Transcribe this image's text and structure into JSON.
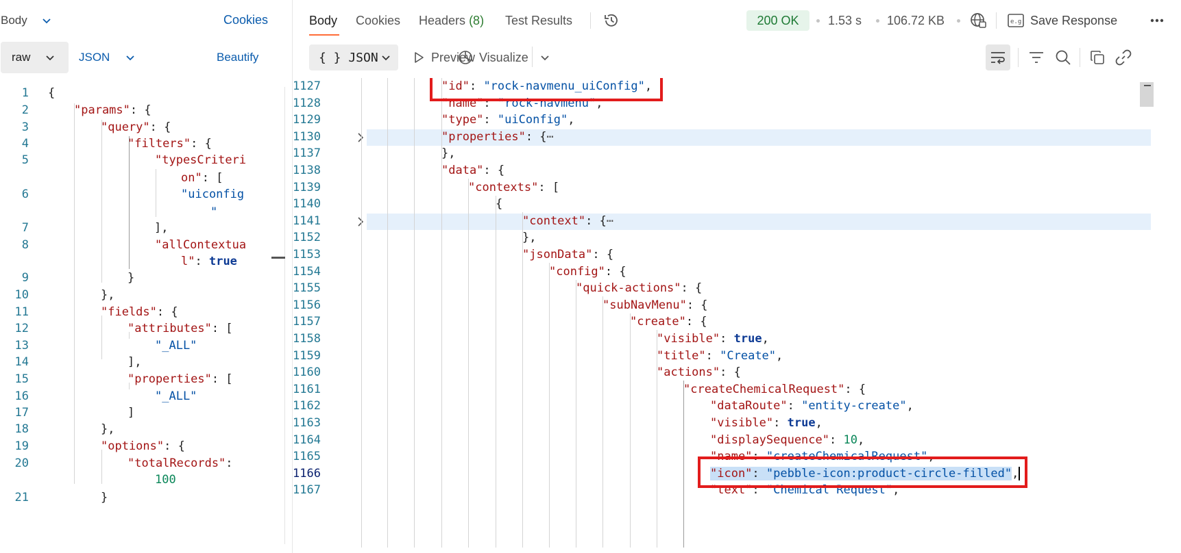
{
  "request": {
    "body_tab": "Body",
    "cookies_link": "Cookies",
    "mode": "raw",
    "language": "JSON",
    "beautify": "Beautify",
    "lines": [
      {
        "n": "1",
        "parts": [
          [
            "p",
            "{"
          ]
        ]
      },
      {
        "n": "2",
        "parts": [
          [
            "k",
            "\"params\""
          ],
          [
            "p",
            ": {"
          ]
        ]
      },
      {
        "n": "3",
        "parts": [
          [
            "k",
            "\"query\""
          ],
          [
            "p",
            ": {"
          ]
        ]
      },
      {
        "n": "4",
        "parts": [
          [
            "k",
            "\"filters\""
          ],
          [
            "p",
            ": {"
          ]
        ]
      },
      {
        "n": "5",
        "parts": [
          [
            "k",
            "\"typesCriteri"
          ]
        ]
      },
      {
        "n": "",
        "parts": [
          [
            "k",
            "on\""
          ],
          [
            "p",
            ": ["
          ]
        ]
      },
      {
        "n": "6",
        "parts": [
          [
            "s",
            "\"uiconfig"
          ]
        ]
      },
      {
        "n": "",
        "parts": [
          [
            "s",
            "\""
          ]
        ]
      },
      {
        "n": "7",
        "parts": [
          [
            "p",
            "],"
          ]
        ]
      },
      {
        "n": "8",
        "parts": [
          [
            "k",
            "\"allContextua"
          ]
        ]
      },
      {
        "n": "",
        "parts": [
          [
            "k",
            "l\""
          ],
          [
            "p",
            ": "
          ],
          [
            "b",
            "true"
          ]
        ]
      },
      {
        "n": "9",
        "parts": [
          [
            "p",
            "}"
          ]
        ]
      },
      {
        "n": "10",
        "parts": [
          [
            "p",
            "},"
          ]
        ]
      },
      {
        "n": "11",
        "parts": [
          [
            "k",
            "\"fields\""
          ],
          [
            "p",
            ": {"
          ]
        ]
      },
      {
        "n": "12",
        "parts": [
          [
            "k",
            "\"attributes\""
          ],
          [
            "p",
            ": ["
          ]
        ]
      },
      {
        "n": "13",
        "parts": [
          [
            "s",
            "\"_ALL\""
          ]
        ]
      },
      {
        "n": "14",
        "parts": [
          [
            "p",
            "],"
          ]
        ]
      },
      {
        "n": "15",
        "parts": [
          [
            "k",
            "\"properties\""
          ],
          [
            "p",
            ": ["
          ]
        ]
      },
      {
        "n": "16",
        "parts": [
          [
            "s",
            "\"_ALL\""
          ]
        ]
      },
      {
        "n": "17",
        "parts": [
          [
            "p",
            "]"
          ]
        ]
      },
      {
        "n": "18",
        "parts": [
          [
            "p",
            "},"
          ]
        ]
      },
      {
        "n": "19",
        "parts": [
          [
            "k",
            "\"options\""
          ],
          [
            "p",
            ": {"
          ]
        ]
      },
      {
        "n": "20",
        "parts": [
          [
            "k",
            "\"totalRecords\""
          ],
          [
            "p",
            ":"
          ]
        ]
      },
      {
        "n": "",
        "parts": [
          [
            "n",
            "100"
          ]
        ]
      },
      {
        "n": "21",
        "parts": [
          [
            "p",
            "}"
          ]
        ]
      }
    ]
  },
  "response": {
    "tabs": {
      "body": "Body",
      "cookies": "Cookies",
      "headers": "Headers",
      "headers_count": "(8)",
      "test_results": "Test Results"
    },
    "status": "200 OK",
    "time": "1.53 s",
    "size": "106.72 KB",
    "save_response": "Save Response",
    "format": "{ } JSON",
    "preview": "Preview",
    "visualize": "Visualize",
    "icons": [
      "history-icon",
      "globe-icon",
      "save-response-icon",
      "more-icon",
      "play-icon",
      "visualize-icon",
      "wrap-icon",
      "filter-icon",
      "search-icon",
      "copy-icon",
      "link-icon"
    ],
    "colors": {
      "accent": "#ff6c37",
      "status_ok_bg": "#e6f4ea",
      "status_ok_text": "#1e7a34",
      "highlight_box": "#e21c1c"
    },
    "lines": [
      {
        "n": "1127",
        "parts": [
          [
            "k",
            "\"id\""
          ],
          [
            "p",
            ": "
          ],
          [
            "s",
            "\"rock-navmenu_uiConfig\""
          ],
          [
            "p",
            ","
          ]
        ]
      },
      {
        "n": "1128",
        "parts": [
          [
            "k",
            "\"name\""
          ],
          [
            "p",
            ": "
          ],
          [
            "s",
            "\"rock-navmenu\""
          ],
          [
            "p",
            ","
          ]
        ]
      },
      {
        "n": "1129",
        "parts": [
          [
            "k",
            "\"type\""
          ],
          [
            "p",
            ": "
          ],
          [
            "s",
            "\"uiConfig\""
          ],
          [
            "p",
            ","
          ]
        ]
      },
      {
        "n": "1130",
        "parts": [
          [
            "k",
            "\"properties\""
          ],
          [
            "p",
            ": {"
          ],
          [
            "e",
            "⋯"
          ]
        ]
      },
      {
        "n": "1137",
        "parts": [
          [
            "p",
            "},"
          ]
        ]
      },
      {
        "n": "1138",
        "parts": [
          [
            "k",
            "\"data\""
          ],
          [
            "p",
            ": {"
          ]
        ]
      },
      {
        "n": "1139",
        "parts": [
          [
            "k",
            "\"contexts\""
          ],
          [
            "p",
            ": ["
          ]
        ]
      },
      {
        "n": "1140",
        "parts": [
          [
            "p",
            "{"
          ]
        ]
      },
      {
        "n": "1141",
        "parts": [
          [
            "k",
            "\"context\""
          ],
          [
            "p",
            ": {"
          ],
          [
            "e",
            "⋯"
          ]
        ]
      },
      {
        "n": "1152",
        "parts": [
          [
            "p",
            "},"
          ]
        ]
      },
      {
        "n": "1153",
        "parts": [
          [
            "k",
            "\"jsonData\""
          ],
          [
            "p",
            ": {"
          ]
        ]
      },
      {
        "n": "1154",
        "parts": [
          [
            "k",
            "\"config\""
          ],
          [
            "p",
            ": {"
          ]
        ]
      },
      {
        "n": "1155",
        "parts": [
          [
            "k",
            "\"quick-actions\""
          ],
          [
            "p",
            ": {"
          ]
        ]
      },
      {
        "n": "1156",
        "parts": [
          [
            "k",
            "\"subNavMenu\""
          ],
          [
            "p",
            ": {"
          ]
        ]
      },
      {
        "n": "1157",
        "parts": [
          [
            "k",
            "\"create\""
          ],
          [
            "p",
            ": {"
          ]
        ]
      },
      {
        "n": "1158",
        "parts": [
          [
            "k",
            "\"visible\""
          ],
          [
            "p",
            ": "
          ],
          [
            "b",
            "true"
          ],
          [
            "p",
            ","
          ]
        ]
      },
      {
        "n": "1159",
        "parts": [
          [
            "k",
            "\"title\""
          ],
          [
            "p",
            ": "
          ],
          [
            "s",
            "\"Create\""
          ],
          [
            "p",
            ","
          ]
        ]
      },
      {
        "n": "1160",
        "parts": [
          [
            "k",
            "\"actions\""
          ],
          [
            "p",
            ": {"
          ]
        ]
      },
      {
        "n": "1161",
        "parts": [
          [
            "k",
            "\"createChemicalRequest\""
          ],
          [
            "p",
            ": {"
          ]
        ]
      },
      {
        "n": "1162",
        "parts": [
          [
            "k",
            "\"dataRoute\""
          ],
          [
            "p",
            ": "
          ],
          [
            "s",
            "\"entity-create\""
          ],
          [
            "p",
            ","
          ]
        ]
      },
      {
        "n": "1163",
        "parts": [
          [
            "k",
            "\"visible\""
          ],
          [
            "p",
            ": "
          ],
          [
            "b",
            "true"
          ],
          [
            "p",
            ","
          ]
        ]
      },
      {
        "n": "1164",
        "parts": [
          [
            "k",
            "\"displaySequence\""
          ],
          [
            "p",
            ": "
          ],
          [
            "n",
            "10"
          ],
          [
            "p",
            ","
          ]
        ]
      },
      {
        "n": "1165",
        "parts": [
          [
            "k",
            "\"name\""
          ],
          [
            "p",
            ": "
          ],
          [
            "s",
            "\"createChemicalRequest\""
          ],
          [
            "p",
            ","
          ]
        ]
      },
      {
        "n": "1166",
        "parts": [
          [
            "k",
            "\"icon\""
          ],
          [
            "p",
            ": "
          ],
          [
            "s",
            "\"pebble-icon:product-circle-filled\""
          ],
          [
            "p",
            ","
          ]
        ]
      },
      {
        "n": "1167",
        "parts": [
          [
            "k",
            "\"text\""
          ],
          [
            "p",
            ": "
          ],
          [
            "s",
            "\"Chemical Request\""
          ],
          [
            "p",
            ","
          ]
        ]
      }
    ]
  }
}
